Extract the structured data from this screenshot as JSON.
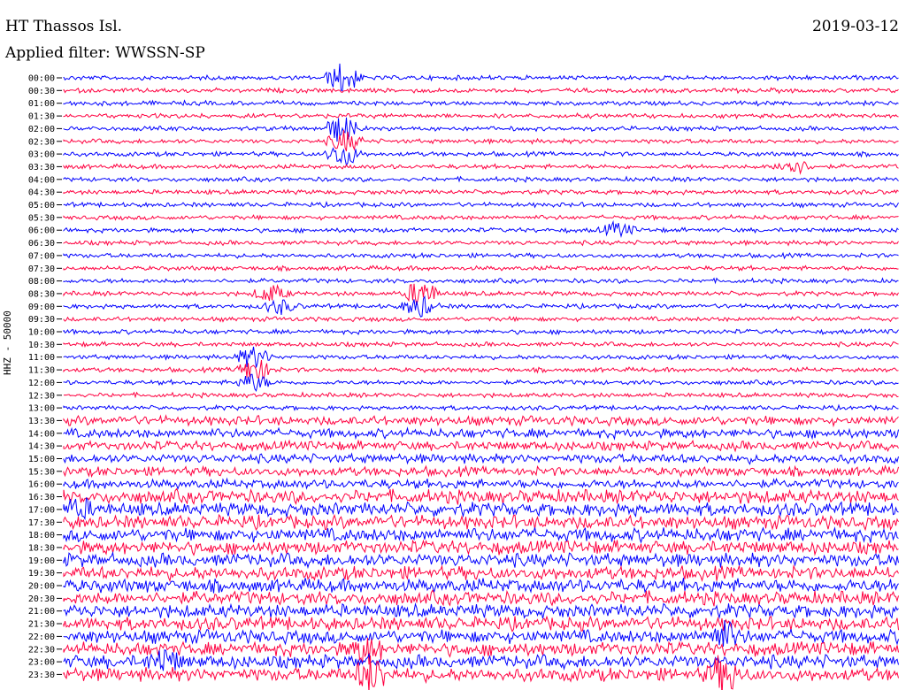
{
  "header": {
    "station": "HT Thassos Isl.",
    "date": "2019-03-12",
    "filter": "Applied filter: WWSSN-SP"
  },
  "chart_data": {
    "type": "line",
    "ylabel": "HHZ - 50000",
    "rows": [
      "00:00",
      "00:30",
      "01:00",
      "01:30",
      "02:00",
      "02:30",
      "03:00",
      "03:30",
      "04:00",
      "04:30",
      "05:00",
      "05:30",
      "06:00",
      "06:30",
      "07:00",
      "07:30",
      "08:00",
      "08:30",
      "09:00",
      "09:30",
      "10:00",
      "10:30",
      "11:00",
      "11:30",
      "12:00",
      "12:30",
      "13:00",
      "13:30",
      "14:00",
      "14:30",
      "15:00",
      "15:30",
      "16:00",
      "16:30",
      "17:00",
      "17:30",
      "18:00",
      "18:30",
      "19:00",
      "19:30",
      "20:00",
      "20:30",
      "21:00",
      "21:30",
      "22:00",
      "22:30",
      "23:00",
      "23:30"
    ],
    "series_colors": [
      "#0000ff",
      "#ff0040"
    ],
    "grid": false,
    "legend": "none"
  }
}
